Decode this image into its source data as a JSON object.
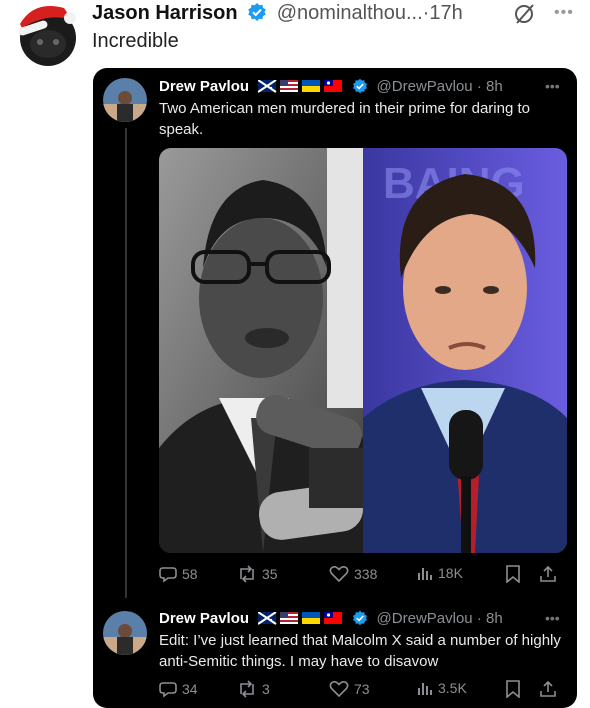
{
  "outer_post": {
    "name": "Jason Harrison",
    "handle": "@nominalthou...",
    "time": "·17h",
    "text": "Incredible",
    "more_icon": "more-horizontal-icon",
    "grok_icon": "grok-slash-icon"
  },
  "quoted_posts": [
    {
      "name": "Drew Pavlou",
      "flags_icon": "country-flags-icon",
      "handle": "@DrewPavlou",
      "time": "· 8h",
      "text": "Two American men murdered in their prime for daring to speak.",
      "media": {
        "left_icon": "photo-bw-man-microphones",
        "right_icon": "photo-color-man-microphone"
      },
      "stats": {
        "replies": "58",
        "reposts": "35",
        "likes": "338",
        "views": "18K"
      }
    },
    {
      "name": "Drew Pavlou",
      "flags_icon": "country-flags-icon",
      "handle": "@DrewPavlou",
      "time": "· 8h",
      "text": "Edit: I’ve just learned that Malcolm X said a number of highly anti-Semitic things. I may have to disavow",
      "stats": {
        "replies": "34",
        "reposts": "3",
        "likes": "73",
        "views": "3.5K"
      }
    }
  ],
  "colors": {
    "card_bg": "#000000",
    "verified": "#1d9bf0",
    "muted": "#8b8f94"
  }
}
